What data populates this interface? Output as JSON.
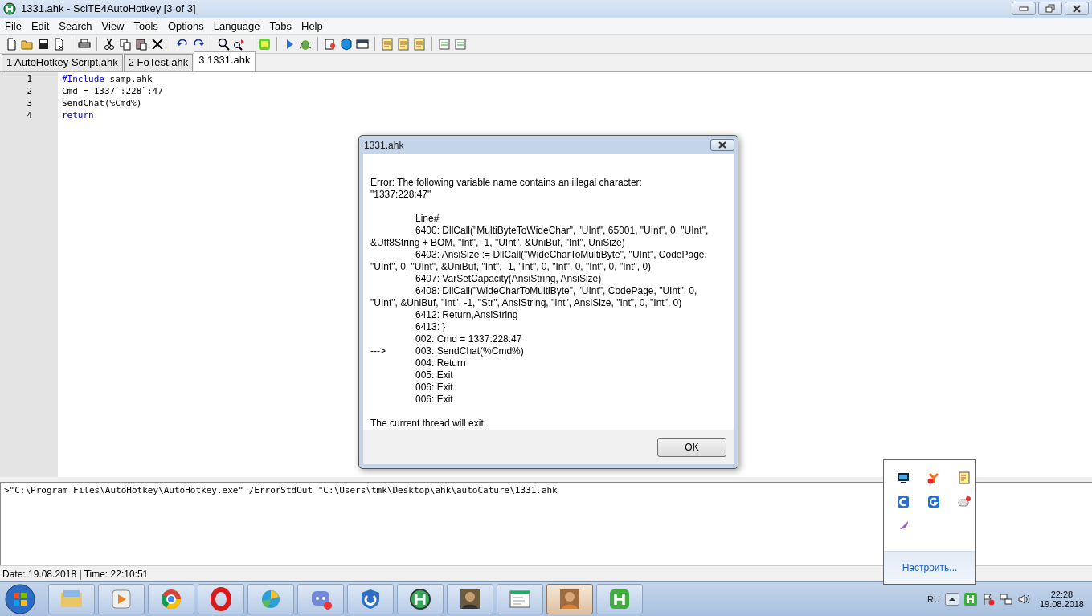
{
  "window": {
    "title": "1331.ahk - SciTE4AutoHotkey [3 of 3]"
  },
  "menu": [
    "File",
    "Edit",
    "Search",
    "View",
    "Tools",
    "Options",
    "Language",
    "Tabs",
    "Help"
  ],
  "tabs": [
    {
      "label": "1 AutoHotkey Script.ahk",
      "selected": false
    },
    {
      "label": "2 FoTest.ahk",
      "selected": false
    },
    {
      "label": "3 1331.ahk",
      "selected": true
    }
  ],
  "editor": {
    "lines": [
      {
        "number": "1",
        "tokens": [
          {
            "text": "#Include",
            "kind": "keyword"
          },
          {
            "text": " samp.ahk",
            "kind": "plain"
          }
        ]
      },
      {
        "number": "2",
        "tokens": [
          {
            "text": "Cmd = 1337`:228`:47",
            "kind": "plain"
          }
        ]
      },
      {
        "number": "3",
        "tokens": [
          {
            "text": "SendChat(%Cmd%)",
            "kind": "plain"
          }
        ]
      },
      {
        "number": "4",
        "tokens": [
          {
            "text": "return",
            "kind": "keyword"
          }
        ]
      }
    ]
  },
  "output": {
    "text": ">\"C:\\Program Files\\AutoHotkey\\AutoHotkey.exe\" /ErrorStdOut \"C:\\Users\\tmk\\Desktop\\ahk\\autoCature\\1331.ahk"
  },
  "status_bar": "Date: 19.08.2018 | Time: 22:10:51",
  "dialog": {
    "title": "1331.ahk",
    "error": [
      "Error:  The following variable name contains an illegal character:",
      "\"1337:228:47\""
    ],
    "lines": [
      {
        "kind": "indented",
        "text": "Line#"
      },
      {
        "kind": "indented",
        "text": "6400: DllCall(\"MultiByteToWideChar\", \"UInt\", 65001, \"UInt\", 0, \"UInt\", &Utf8String + BOM, \"Int\", -1, \"UInt\", &UniBuf, \"Int\", UniSize)"
      },
      {
        "kind": "indented",
        "text": "6403: AnsiSize := DllCall(\"WideCharToMultiByte\", \"UInt\", CodePage, \"UInt\", 0, \"UInt\", &UniBuf, \"Int\", -1, \"Int\", 0, \"Int\", 0, \"Int\", 0, \"Int\", 0)"
      },
      {
        "kind": "indented",
        "text": "6407: VarSetCapacity(AnsiString, AnsiSize)"
      },
      {
        "kind": "indented",
        "text": "6408: DllCall(\"WideCharToMultiByte\", \"UInt\", CodePage, \"UInt\", 0, \"UInt\", &UniBuf, \"Int\", -1, \"Str\", AnsiString, \"Int\", AnsiSize, \"Int\", 0, \"Int\", 0)"
      },
      {
        "kind": "indented",
        "text": "6412: Return,AnsiString"
      },
      {
        "kind": "indented",
        "text": "6413: }"
      },
      {
        "kind": "indented",
        "text": "002: Cmd = 1337:228:47"
      },
      {
        "kind": "arrow",
        "marker": "--->",
        "text": "003: SendChat(%Cmd%)"
      },
      {
        "kind": "indented",
        "text": "004: Return"
      },
      {
        "kind": "indented",
        "text": "005: Exit"
      },
      {
        "kind": "indented",
        "text": "006: Exit"
      },
      {
        "kind": "indented",
        "text": "006: Exit"
      }
    ],
    "footer": "The current thread will exit.",
    "button": "OK"
  },
  "tray_popup": {
    "link": "Настроить..."
  },
  "taskbar": {
    "apps": [
      {
        "selected": false
      },
      {
        "selected": false
      },
      {
        "selected": false
      },
      {
        "selected": false
      },
      {
        "selected": false
      },
      {
        "selected": false
      },
      {
        "selected": false
      },
      {
        "selected": false
      },
      {
        "selected": false
      },
      {
        "selected": false
      },
      {
        "selected": true
      },
      {
        "selected": false
      }
    ],
    "language": "RU",
    "time": "22:28",
    "date": "19.08.2018"
  }
}
